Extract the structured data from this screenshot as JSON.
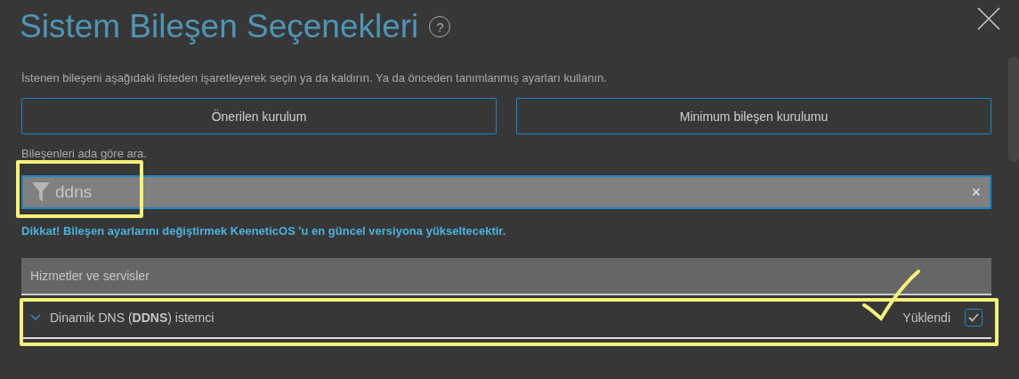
{
  "dialog": {
    "title": "Sistem Bileşen Seçenekleri",
    "help": "?"
  },
  "description": "İstenen bileşeni aşağıdaki listeden işaretleyerek seçin ya da kaldırın. Ya da önceden tanımlanmış ayarları kullanın.",
  "presets": [
    "Önerilen kurulum",
    "Minimum bileşen kurulumu"
  ],
  "search": {
    "label": "Bileşenleri ada göre ara.",
    "value": "ddns",
    "clear": "×"
  },
  "warning": "Dikkat! Bileşen ayarlarını değiştirmek KeeneticOS 'u en güncel versiyona yükseltecektir.",
  "groups": [
    {
      "title": "Hizmetler ve servisler",
      "components": [
        {
          "name": "Dinamik DNS (**DDNS**) istemci",
          "expanded": false,
          "status": "Yüklendi",
          "checked": true
        }
      ]
    }
  ]
}
